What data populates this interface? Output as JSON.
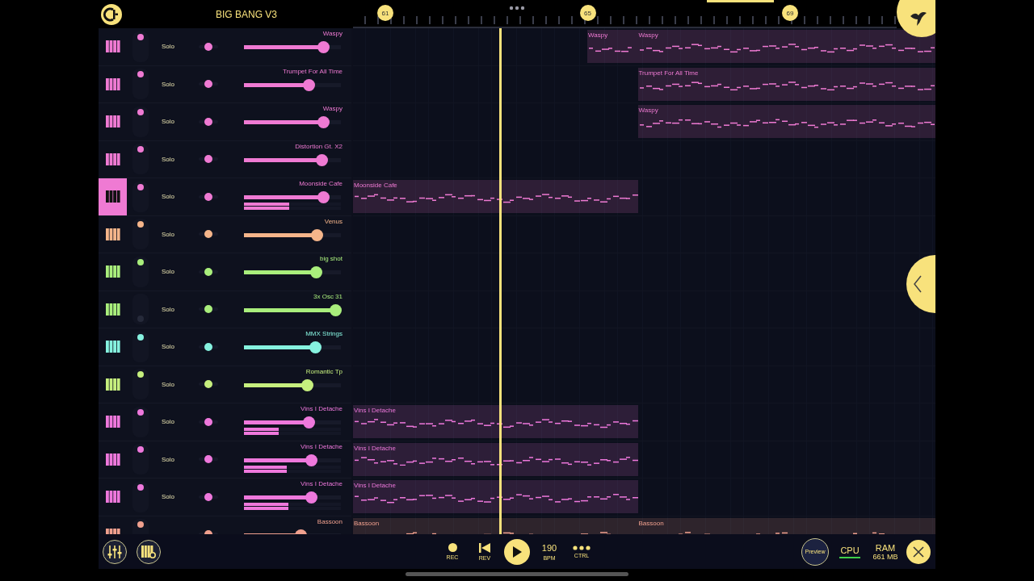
{
  "header": {
    "title": "BIG BANG V3"
  },
  "ruler": {
    "markers": [
      "61",
      "65",
      "69"
    ]
  },
  "tracks": [
    {
      "name": "Waspy",
      "color": "#ef7ad3",
      "selected": false,
      "on": true,
      "solo": "Solo",
      "pan": {
        "level": 0.5
      },
      "level": 0.82,
      "clips": [
        {
          "label": "Waspy",
          "kind": "short"
        },
        {
          "label": "Waspy",
          "kind": "tail"
        }
      ]
    },
    {
      "name": "Trumpet For All Time",
      "color": "#ef7ad3",
      "selected": false,
      "on": true,
      "solo": "Solo",
      "pan": {
        "level": 0.5
      },
      "level": 0.67,
      "clips": [
        {
          "label": "Trumpet For All Time",
          "kind": "tail"
        }
      ]
    },
    {
      "name": "Waspy",
      "color": "#ef7ad3",
      "selected": false,
      "on": true,
      "solo": "Solo",
      "pan": {
        "level": 0.5
      },
      "level": 0.82,
      "clips": [
        {
          "label": "Waspy",
          "kind": "tail"
        }
      ]
    },
    {
      "name": "Distortion Gt. X2",
      "color": "#ef7ad3",
      "selected": false,
      "on": true,
      "solo": "Solo",
      "pan": {
        "level": 0.5
      },
      "level": 0.8
    },
    {
      "name": "Moonside Cafe",
      "color": "#ef7ad3",
      "selected": true,
      "on": true,
      "solo": "Solo",
      "pan": {
        "level": 0.5
      },
      "level": 0.82,
      "meters": [
        {
          "level": 0.47
        },
        {
          "level": 0.47
        }
      ],
      "clips": [
        {
          "label": "Moonside Cafe",
          "kind": "lead"
        }
      ]
    },
    {
      "name": "Venus",
      "color": "#f5b58a",
      "selected": false,
      "on": true,
      "solo": "Solo",
      "pan": {
        "level": 0.5
      },
      "level": 0.75
    },
    {
      "name": "big shot",
      "color": "#a9ee7c",
      "selected": false,
      "on": true,
      "solo": "Solo",
      "pan": {
        "level": 0.5
      },
      "level": 0.74
    },
    {
      "name": "3x Osc 31",
      "color": "#a9ee7c",
      "selected": false,
      "on": false,
      "solo": "Solo",
      "pan": {
        "level": 0.5
      },
      "level": 0.94
    },
    {
      "name": "MMX Strings",
      "color": "#86f2df",
      "selected": false,
      "on": true,
      "solo": "Solo",
      "pan": {
        "level": 0.5
      },
      "level": 0.73
    },
    {
      "name": "Romantic Tp",
      "color": "#c6ef7e",
      "selected": false,
      "on": true,
      "solo": "Solo",
      "pan": {
        "level": 0.5
      },
      "level": 0.65
    },
    {
      "name": "Vins I Detache",
      "color": "#ee78dc",
      "selected": false,
      "on": true,
      "solo": "Solo",
      "pan": {
        "level": 0.5
      },
      "level": 0.67,
      "meters": [
        {
          "level": 0.36
        },
        {
          "level": 0.36
        }
      ],
      "clips": [
        {
          "label": "Vins I Detache",
          "kind": "lead"
        }
      ]
    },
    {
      "name": "Vins I Detache",
      "color": "#ee78dc",
      "selected": false,
      "on": true,
      "solo": "Solo",
      "pan": {
        "level": 0.5
      },
      "level": 0.69,
      "meters": [
        {
          "level": 0.44
        },
        {
          "level": 0.44
        }
      ],
      "clips": [
        {
          "label": "Vins I Detache",
          "kind": "lead"
        }
      ]
    },
    {
      "name": "Vins I Detache",
      "color": "#ee78dc",
      "selected": false,
      "on": true,
      "solo": "Solo",
      "pan": {
        "level": 0.5
      },
      "level": 0.69,
      "meters": [
        {
          "level": 0.46
        },
        {
          "level": 0.46
        }
      ],
      "clips": [
        {
          "label": "Vins I Detache",
          "kind": "lead"
        }
      ]
    },
    {
      "name": "Bassoon",
      "color": "#f0a08e",
      "selected": false,
      "on": true,
      "pan": {
        "level": 0.5
      },
      "level": 0.58,
      "clips": [
        {
          "label": "Bassoon",
          "kind": "lead"
        },
        {
          "label": "Bassoon",
          "kind": "tail"
        }
      ]
    }
  ],
  "transport": {
    "rec": "REC",
    "rev": "REV",
    "playing": false,
    "bpm": "190",
    "bpm_label": "BPM",
    "ctrl": "CTRL",
    "preview": "Preview",
    "cpu": "CPU",
    "ram": "RAM",
    "ram_value": "661 MB"
  }
}
